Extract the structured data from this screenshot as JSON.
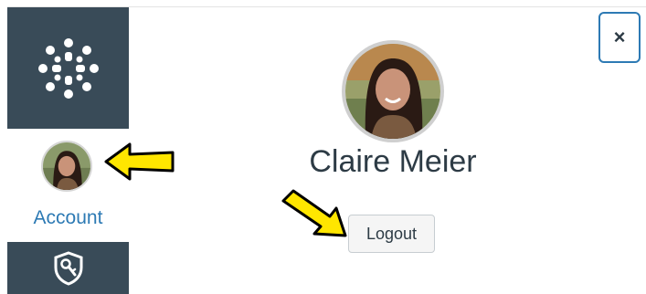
{
  "sidebar": {
    "logo_icon": "canvas-logo-icon",
    "account_label": "Account",
    "admin_icon": "admin-shield-icon",
    "background_color": "#394b58",
    "account_label_color": "#2d7ab4"
  },
  "profile": {
    "name": "Claire Meier",
    "logout_label": "Logout",
    "close_label": "×"
  },
  "annotations": {
    "arrow_color": "#ffe600"
  }
}
